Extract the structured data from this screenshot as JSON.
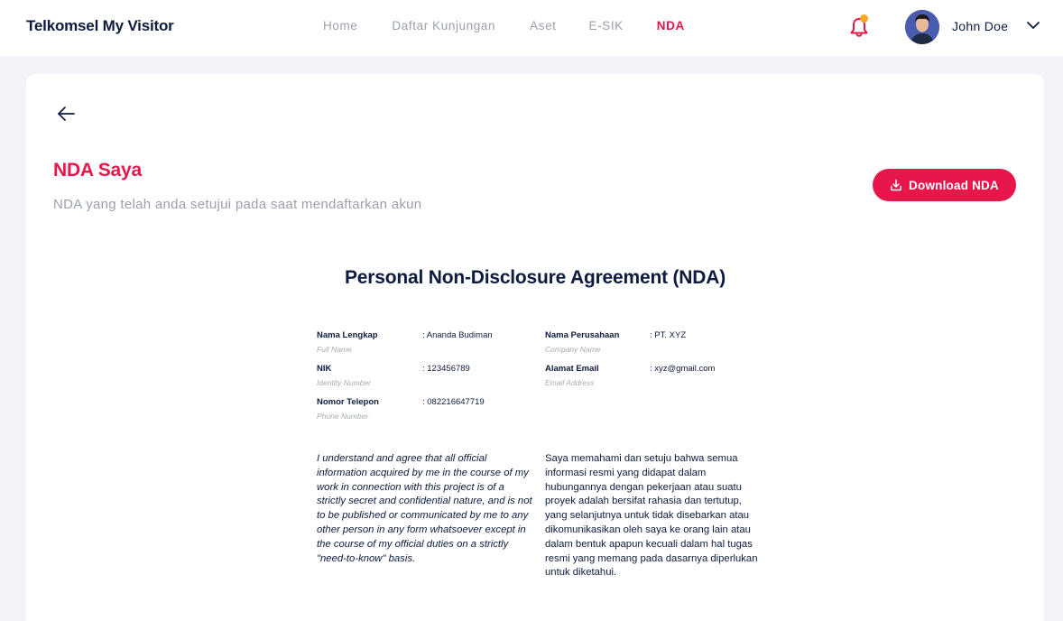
{
  "header": {
    "brand": "Telkomsel My Visitor",
    "nav": [
      {
        "label": "Home"
      },
      {
        "label": "Daftar Kunjungan"
      },
      {
        "label": "Aset"
      },
      {
        "label": "E-SIK"
      },
      {
        "label": "NDA",
        "active": true
      }
    ],
    "user_name": "John Doe",
    "icons": [
      "bell-icon",
      "chevron-down-icon"
    ],
    "colors": {
      "accent": "#e8174b",
      "notification_dot": "#f5a623"
    }
  },
  "page": {
    "title": "NDA Saya",
    "subtitle": "NDA yang telah anda setujui pada saat mendaftarkan akun",
    "download_label": "Download NDA"
  },
  "document": {
    "title": "Personal Non-Disclosure Agreement (NDA)",
    "fields": [
      {
        "label": "Nama Lengkap",
        "sub": "Full Name",
        "value": ": Ananda Budiman"
      },
      {
        "label": "NIK",
        "sub": "Identity Number",
        "value": ": 123456789"
      },
      {
        "label": "Nomor Telepon",
        "sub": "Phone Number",
        "value": ": 082216647719"
      },
      {
        "label": "Nama Perusahaan",
        "sub": "Company Name",
        "value": ": PT. XYZ"
      },
      {
        "label": "Alamat Email",
        "sub": "Email Address",
        "value": ": xyz@gmail.com"
      }
    ],
    "statement_en": "I understand and agree that all official information acquired by me in the course of my work in connection with this project is of a strictly secret and confidential nature, and is not to be published or communicated by me to any other person in any form whatsoever except in the course of my official duties on a strictly \"need-to-know\" basis.",
    "statement_id": "Saya memahami dan setuju bahwa semua informasi resmi yang didapat dalam hubungannya dengan pekerjaan atau suatu proyek adalah bersifat rahasia dan tertutup, yang selanjutnya untuk tidak disebarkan atau dikomunikasikan oleh saya ke orang lain atau dalam bentuk apapun kecuali dalam hal tugas resmi yang memang pada dasarnya diperlukan untuk diketahui."
  }
}
